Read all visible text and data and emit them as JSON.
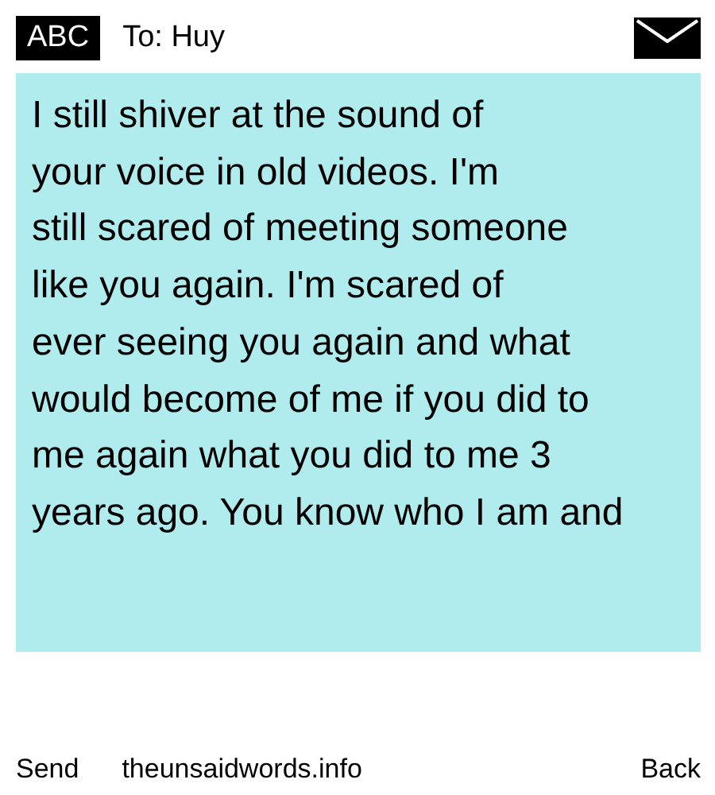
{
  "header": {
    "badge": "ABC",
    "recipient": "To: Huy"
  },
  "message": {
    "text": "I still shiver at the sound of\nyour voice in old videos. I'm\nstill scared of meeting someone\nlike you again. I'm scared of\never seeing you again and what\nwould become of me if you did to\nme again what you did to me 3\nyears ago. You know who I am and"
  },
  "footer": {
    "left": "Send",
    "site": "theunsaidwords.info",
    "right": "Back"
  }
}
